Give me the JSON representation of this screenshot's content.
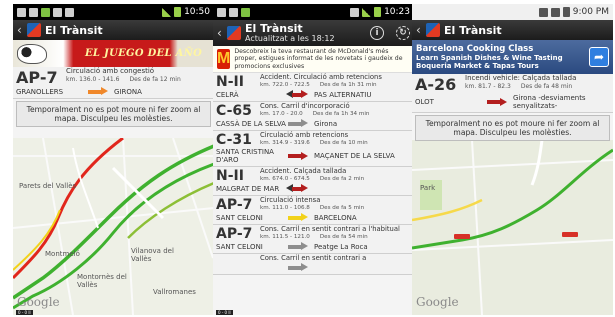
{
  "phones": [
    {
      "status": {
        "time": "10:50"
      },
      "title": "El Trànsit",
      "banner": {
        "text": "EL JUEGO DEL AÑO"
      },
      "card": {
        "road": "AP-7",
        "incident": "Circulació amb congestió",
        "km": "km. 136.0 - 141.6",
        "since": "Des de fa 12 min",
        "from": "GRANOLLERS",
        "to": "GIRONA",
        "arrow_color": "#f0882a"
      },
      "notice": "Temporalment no es pot moure ni fer zoom al mapa. Disculpeu les molèsties.",
      "map": {
        "labels": [
          "Parets del Vallès",
          "Montmeló",
          "Vilanova del Vallès",
          "Montornès del Vallès",
          "Vallromanes"
        ],
        "google": "Google",
        "scale": "0 - 0 ll"
      }
    },
    {
      "status": {
        "time": "10:23"
      },
      "title": "El Trànsit",
      "subtitle": "Actualitzat a les 18:12",
      "info_label": "i",
      "banner": {
        "logo": "M",
        "text": "Descobreix la teva restaurant de McDonald's més proper, estigues informat de les novetats i gaudeix de promocions exclusives"
      },
      "items": [
        {
          "road": "N-II",
          "incident": "Accident. Circulació amb retencions",
          "km": "km. 722.0 - 722.5",
          "since": "Des de fa 1h 31 min",
          "from": "CELRÀ",
          "to": "PAS ALTERNATIU",
          "arrow": "both",
          "color": "red"
        },
        {
          "road": "C-65",
          "incident": "Cons. Carril d'incorporació",
          "km": "km. 17.0 - 20.0",
          "since": "Des de fa 1h 34 min",
          "from": "CASSÀ DE LA SELVA",
          "to": "Girona",
          "arrow": "right",
          "color": "gray"
        },
        {
          "road": "C-31",
          "incident": "Circulació amb retencions",
          "km": "km. 314.9 - 319.6",
          "since": "Des de fa 10 min",
          "from": "SANTA CRISTINA D'ARO",
          "to": "MAÇANET DE LA SELVA",
          "arrow": "right",
          "color": "red"
        },
        {
          "road": "N-II",
          "incident": "Accident. Calçada tallada",
          "km": "km. 674.0 - 674.5",
          "since": "Des de fa 2 min",
          "from": "MALGRAT DE MAR",
          "to": "",
          "arrow": "both",
          "color": "red"
        },
        {
          "road": "AP-7",
          "incident": "Circulació intensa",
          "km": "km. 111.0 - 106.8",
          "since": "Des de fa 5 min",
          "from": "SANT CELONI",
          "to": "BARCELONA",
          "arrow": "right",
          "color": "yellow"
        },
        {
          "road": "AP-7",
          "incident": "Cons. Carril en sentit contrari a l'habitual",
          "km": "km. 111.5 - 121.0",
          "since": "Des de fa 54 min",
          "from": "SANT CELONI",
          "to": "Peatge La Roca",
          "arrow": "right",
          "color": "gray"
        },
        {
          "road": "",
          "incident": "Cons. Carril en sentit contrari a",
          "km": "",
          "since": "",
          "from": "",
          "to": "",
          "arrow": "right",
          "color": "gray"
        }
      ],
      "scale": "0 - 0 ll"
    },
    {
      "status": {
        "time": "9:00 PM"
      },
      "title": "El Trànsit",
      "banner": {
        "title": "Barcelona Cooking Class",
        "text": "Learn Spanish Dishes & Wine Tasting Boqueria Market & Tapas Tours"
      },
      "card": {
        "road": "A-26",
        "incident": "Incendi vehicle: Calçada tallada",
        "km": "km. 81.7 - 82.3",
        "since": "Des de fa 48 min",
        "from": "OLOT",
        "to": "Girona -desviaments senyalitzats-",
        "arrow_color": "#b31e1e"
      },
      "notice": "Temporalment no es pot moure ni fer zoom al mapa. Disculpeu les molèsties.",
      "map": {
        "labels": [
          "Park"
        ],
        "google": "Google"
      }
    }
  ],
  "colors": {
    "accent_red": "#b31e1e",
    "accent_orange": "#f0882a",
    "accent_yellow": "#f2d21a",
    "accent_gray": "#8e8e8e",
    "highway_green": "#3fb12f"
  }
}
